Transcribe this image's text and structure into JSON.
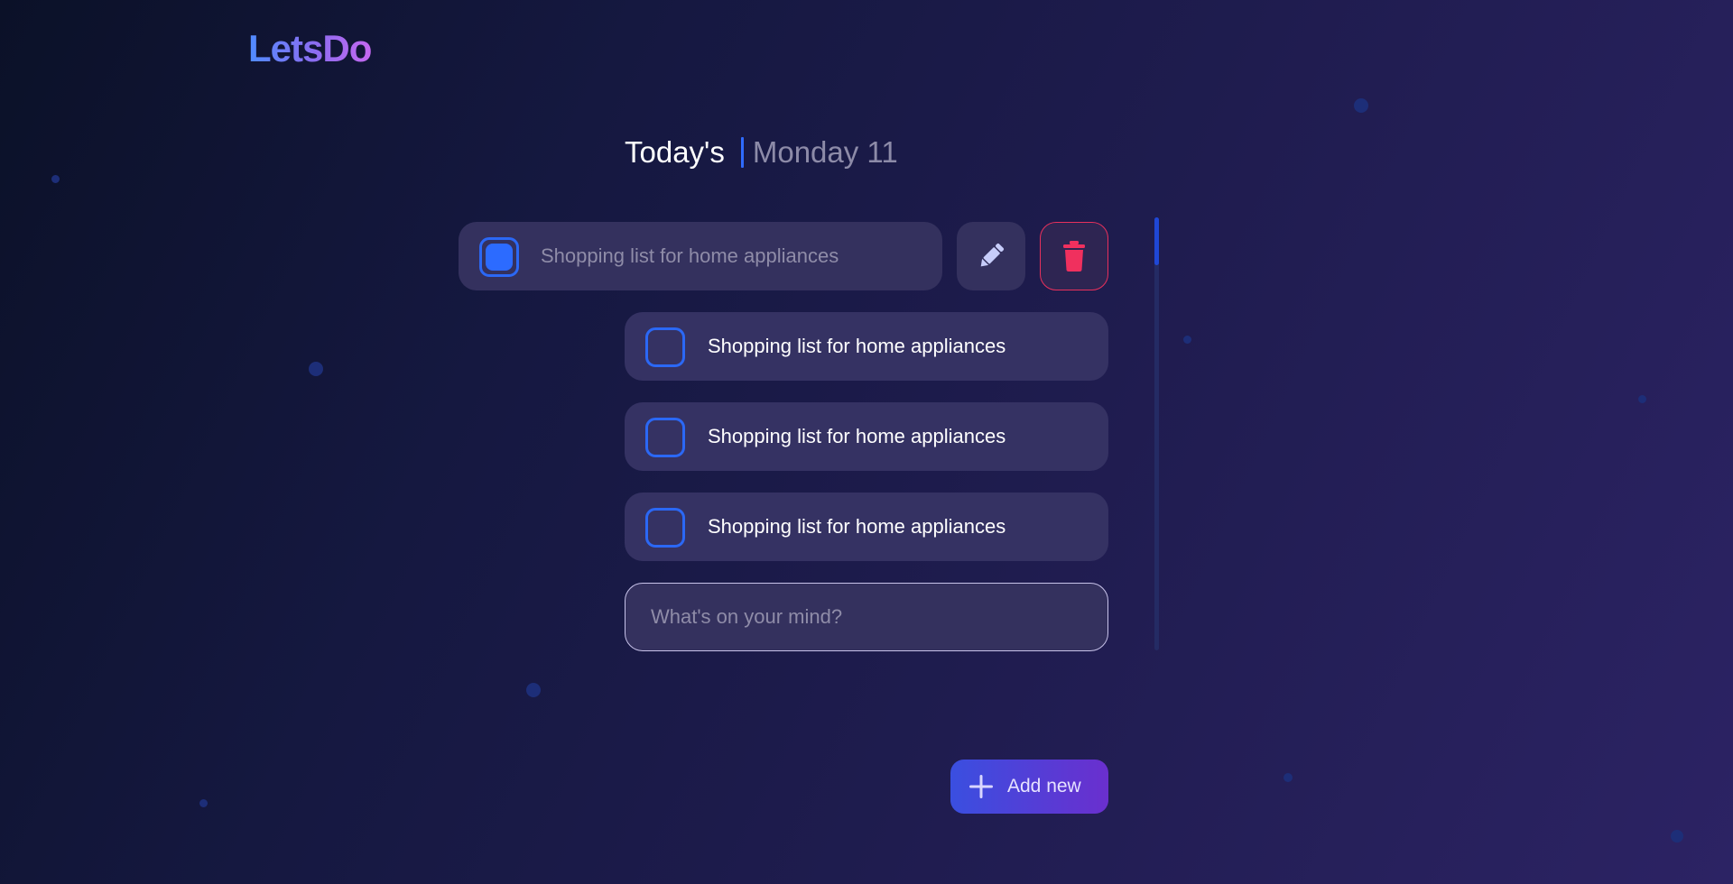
{
  "brand": {
    "logo_text": "LetsDo"
  },
  "header": {
    "title": "Today's",
    "date": "Monday 11"
  },
  "tasks": [
    {
      "text": "Shopping list for home appliances",
      "checked": true,
      "editing": true
    },
    {
      "text": "Shopping list for home appliances",
      "checked": false,
      "editing": false
    },
    {
      "text": "Shopping list for home appliances",
      "checked": false,
      "editing": false
    },
    {
      "text": "Shopping list for home appliances",
      "checked": false,
      "editing": false
    }
  ],
  "new_task": {
    "placeholder": "What's on your mind?",
    "value": ""
  },
  "actions": {
    "add_label": "Add new"
  },
  "icons": {
    "edit": "pencil-icon",
    "delete": "trash-icon",
    "add": "plus-icon"
  },
  "colors": {
    "accent": "#2b68f5",
    "delete": "#e8305c",
    "row_bg": "#353263",
    "add_gradient_start": "#3a4fe0",
    "add_gradient_end": "#6a2fce"
  }
}
